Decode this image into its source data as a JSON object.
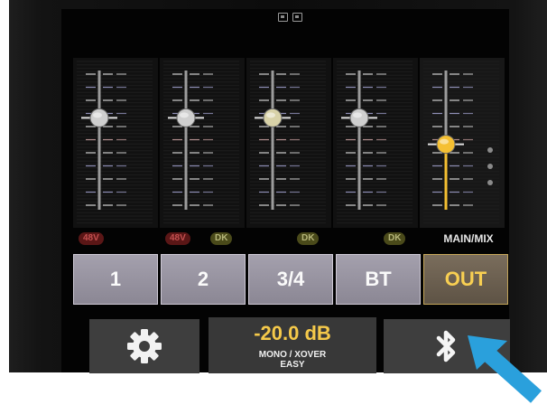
{
  "status_icons": [
    "screenshot-icon",
    "record-icon"
  ],
  "channels": [
    {
      "badges": [
        {
          "kind": "48v",
          "text": "48V"
        }
      ],
      "level": 0.66,
      "knob_color": "#cfcfcf"
    },
    {
      "badges": [
        {
          "kind": "48v",
          "text": "48V"
        },
        {
          "kind": "dk",
          "text": "DK"
        }
      ],
      "level": 0.66,
      "knob_color": "#cfcfcf"
    },
    {
      "badges": [
        {
          "kind": "dk",
          "text": "DK"
        }
      ],
      "level": 0.66,
      "knob_color": "#d8d2a8"
    },
    {
      "badges": [
        {
          "kind": "dk",
          "text": "DK"
        }
      ],
      "level": 0.66,
      "knob_color": "#cfcfcf"
    }
  ],
  "main_mix": {
    "label": "MAIN/MIX",
    "level": 0.47,
    "knob_color": "#f5c032"
  },
  "channel_buttons": [
    {
      "label": "1"
    },
    {
      "label": "2"
    },
    {
      "label": "3/4"
    },
    {
      "label": "BT"
    },
    {
      "label": "OUT"
    }
  ],
  "gain": {
    "value": "-20.0 dB",
    "mode_line1": "MONO / XOVER",
    "mode_line2": "EASY"
  },
  "icons": {
    "settings": "gear-icon",
    "bluetooth": "bluetooth-icon",
    "pointer": "arrow-pointer-icon"
  },
  "colors": {
    "accent": "#f5c94a",
    "phantom": "#c45050",
    "dk": "#b6b67a"
  }
}
